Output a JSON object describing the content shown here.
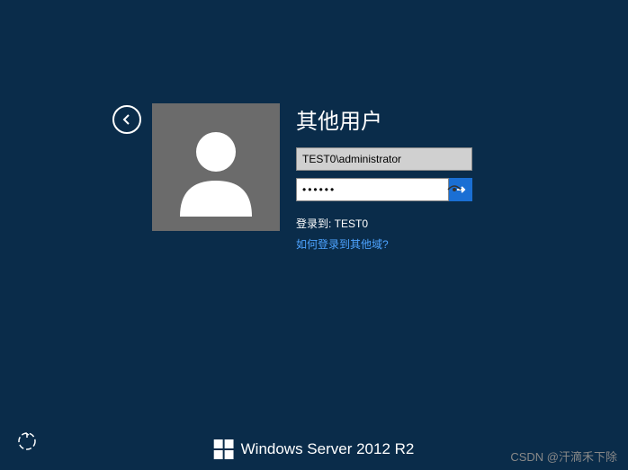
{
  "login": {
    "title": "其他用户",
    "username_value": "TEST0\\administrator",
    "password_value": "••••••",
    "logon_to_label": "登录到: TEST0",
    "how_other_domain_link": "如何登录到其他域?"
  },
  "branding": {
    "product_name": "Windows Server 2012 R2"
  },
  "watermark": "CSDN @汗滴禾下除"
}
